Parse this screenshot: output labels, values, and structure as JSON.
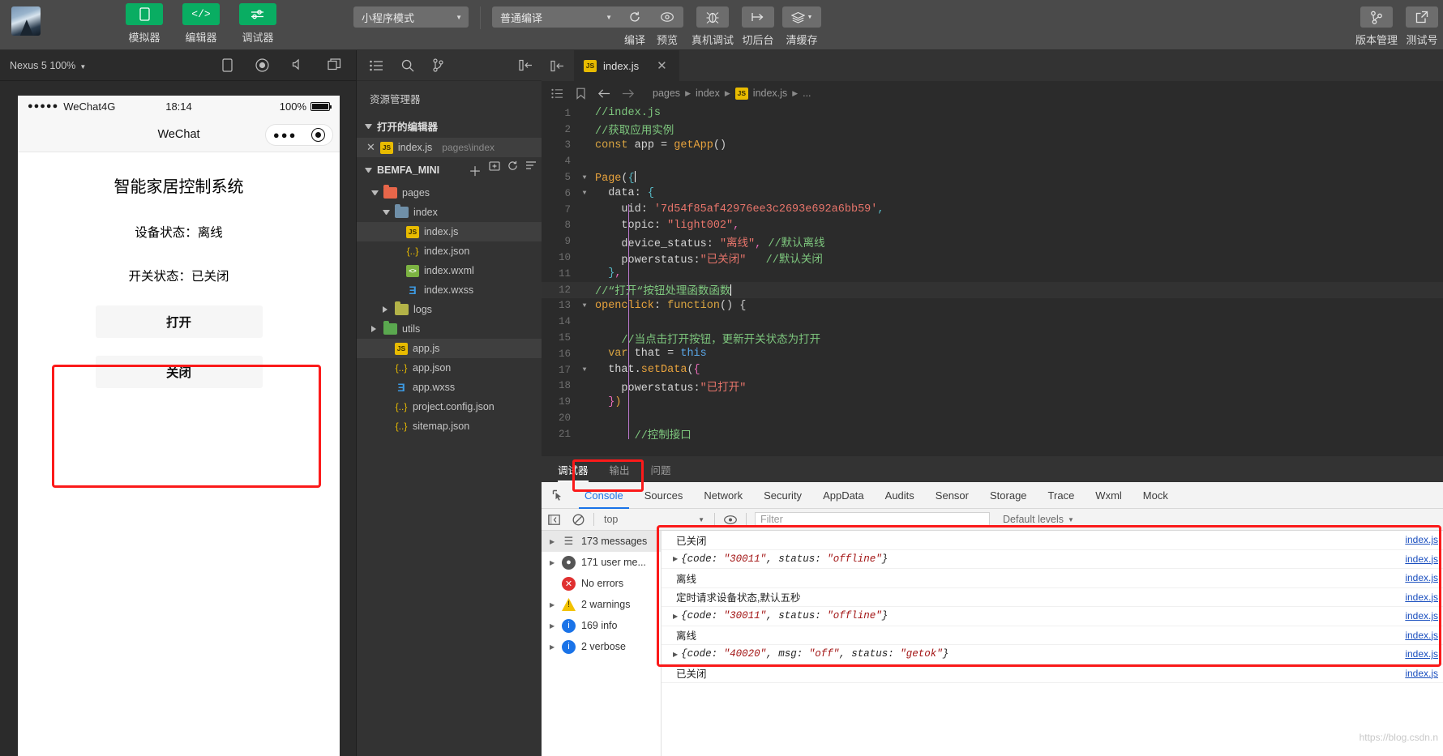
{
  "toolbar": {
    "avatar_name": "user-avatar",
    "buttons": [
      {
        "label": "模拟器",
        "icon": "phone-icon"
      },
      {
        "label": "编辑器",
        "icon": "code-icon"
      },
      {
        "label": "调试器",
        "icon": "sliders-icon"
      }
    ],
    "mode_select": "小程序模式",
    "compile_select": "普通编译",
    "actions": [
      {
        "label": "编译",
        "icon": "refresh-icon"
      },
      {
        "label": "预览",
        "icon": "eye-icon"
      },
      {
        "label": "真机调试",
        "icon": "bug-icon"
      },
      {
        "label": "切后台",
        "icon": "background-icon"
      },
      {
        "label": "清缓存",
        "icon": "layers-icon"
      }
    ],
    "right_actions": [
      {
        "label": "版本管理",
        "icon": "branch-icon"
      },
      {
        "label": "测试号",
        "icon": "external-link-icon"
      }
    ]
  },
  "simulator": {
    "device": "Nexus 5 100%",
    "status_bar": {
      "carrier": "WeChat4G",
      "dots": "●●●●●",
      "time": "18:14",
      "battery": "100%"
    },
    "nav_title": "WeChat",
    "page": {
      "title": "智能家居控制系统",
      "device_status": "设备状态：离线",
      "switch_status": "开关状态：已关闭",
      "open_button": "打开",
      "close_button": "关闭"
    }
  },
  "explorer": {
    "title": "资源管理器",
    "open_editors_label": "打开的编辑器",
    "open_editor_file": "index.js",
    "open_editor_path": "pages\\index",
    "project_name": "BEMFA_MINI",
    "tree": [
      {
        "name": "pages",
        "type": "folder",
        "color": "red",
        "indent": 1,
        "expanded": true,
        "selected": false
      },
      {
        "name": "index",
        "type": "folder",
        "color": "blue",
        "indent": 2,
        "expanded": true,
        "selected": false
      },
      {
        "name": "index.js",
        "type": "js",
        "indent": 3,
        "selected": true
      },
      {
        "name": "index.json",
        "type": "json",
        "indent": 3,
        "selected": false
      },
      {
        "name": "index.wxml",
        "type": "wxml",
        "indent": 3,
        "selected": false
      },
      {
        "name": "index.wxss",
        "type": "wxss",
        "indent": 3,
        "selected": false
      },
      {
        "name": "logs",
        "type": "folder",
        "color": "olive",
        "indent": 2,
        "expanded": false,
        "selected": false
      },
      {
        "name": "utils",
        "type": "folder",
        "color": "green",
        "indent": 1,
        "expanded": false,
        "selected": false
      },
      {
        "name": "app.js",
        "type": "js",
        "indent": 2,
        "selected": true
      },
      {
        "name": "app.json",
        "type": "json",
        "indent": 2,
        "selected": false
      },
      {
        "name": "app.wxss",
        "type": "wxss",
        "indent": 2,
        "selected": false
      },
      {
        "name": "project.config.json",
        "type": "json",
        "indent": 2,
        "selected": false
      },
      {
        "name": "sitemap.json",
        "type": "json",
        "indent": 2,
        "selected": false
      }
    ]
  },
  "editor": {
    "tab_name": "index.js",
    "breadcrumb": [
      "pages",
      "index",
      "index.js",
      "..."
    ],
    "lines": [
      {
        "n": 1,
        "fold": "",
        "html": "<span class='c-cmt'>//index.js</span>"
      },
      {
        "n": 2,
        "fold": "",
        "html": "<span class='c-cmt'>//获取应用实例</span>"
      },
      {
        "n": 3,
        "fold": "",
        "html": "<span class='c-key'>const</span><span class='c-pl'> app </span><span class='c-pun'>=</span><span class='c-fn'> getApp</span><span class='c-pun'>()</span>"
      },
      {
        "n": 4,
        "fold": "",
        "html": ""
      },
      {
        "n": 5,
        "fold": "v",
        "html": "<span class='c-fn'>Page</span><span class='c-pun'>(</span><span class='c-cyan'>{</span><span class='caret'></span>"
      },
      {
        "n": 6,
        "fold": "v",
        "html": "  <span class='c-pl'>data:</span> <span class='c-cyan'>{</span>"
      },
      {
        "n": 7,
        "fold": "",
        "html": "    <span class='c-pl'>uid:</span> <span class='c-str'>'7d54f85af42976ee3c2693e692a6bb59'</span><span class='c-cyan'>,</span>"
      },
      {
        "n": 8,
        "fold": "",
        "html": "    <span class='c-pl'>topic:</span> <span class='c-str'>\"light002\"</span><span class='c-pink'>,</span>"
      },
      {
        "n": 9,
        "fold": "",
        "html": "    <span class='c-pl'>device_status:</span> <span class='c-str'>\"离线\"</span><span class='c-pink'>,</span> <span class='c-cmt'>//默认离线</span>"
      },
      {
        "n": 10,
        "fold": "",
        "html": "    <span class='c-pl'>powerstatus:</span><span class='c-str'>\"已关闭\"</span>   <span class='c-cmt'>//默认关闭</span>"
      },
      {
        "n": 11,
        "fold": "",
        "html": "  <span class='c-cyan'>}</span><span class='c-pink'>,</span>"
      },
      {
        "n": 12,
        "fold": "",
        "hl": true,
        "html": "<span class='c-cmt'>//“打开“按钮处理函数函数</span><span class='caret'></span>"
      },
      {
        "n": 13,
        "fold": "v",
        "html": "<span class='c-fn'>openclick</span><span class='c-pl'>: </span><span class='c-key'>function</span><span class='c-pun'>() {</span>"
      },
      {
        "n": 14,
        "fold": "",
        "html": ""
      },
      {
        "n": 15,
        "fold": "",
        "html": "    <span class='c-cmt'>//当点击打开按钮，更新开关状态为打开</span>"
      },
      {
        "n": 16,
        "fold": "",
        "html": "  <span class='c-key'>var</span><span class='c-pl'> that </span><span class='c-pun'>=</span> <span class='c-blue'>this</span>"
      },
      {
        "n": 17,
        "fold": "v",
        "html": "  <span class='c-pl'>that.</span><span class='c-fn'>setData</span><span class='c-pun'>(</span><span class='c-pink'>{</span>"
      },
      {
        "n": 18,
        "fold": "",
        "html": "    <span class='c-pl'>powerstatus:</span><span class='c-str'>\"已打开\"</span>"
      },
      {
        "n": 19,
        "fold": "",
        "html": "  <span class='c-pink'>}</span><span class='c-fn'>)</span>"
      },
      {
        "n": 20,
        "fold": "",
        "html": ""
      },
      {
        "n": 21,
        "fold": "",
        "html": "      <span class='c-cmt'>//控制接口</span>"
      }
    ]
  },
  "debug": {
    "panel_tabs": [
      {
        "label": "调试器",
        "active": true
      },
      {
        "label": "输出",
        "active": false
      },
      {
        "label": "问题",
        "active": false
      }
    ],
    "devtools_tabs": [
      {
        "label": "Console",
        "active": true
      },
      {
        "label": "Sources",
        "active": false
      },
      {
        "label": "Network",
        "active": false
      },
      {
        "label": "Security",
        "active": false
      },
      {
        "label": "AppData",
        "active": false
      },
      {
        "label": "Audits",
        "active": false
      },
      {
        "label": "Sensor",
        "active": false
      },
      {
        "label": "Storage",
        "active": false
      },
      {
        "label": "Trace",
        "active": false
      },
      {
        "label": "Wxml",
        "active": false
      },
      {
        "label": "Mock",
        "active": false
      }
    ],
    "filterbar": {
      "context": "top",
      "filter_placeholder": "Filter",
      "levels": "Default levels"
    },
    "sidebar": [
      {
        "label": "173 messages",
        "icon": "list-icon",
        "expandable": true,
        "selected": true
      },
      {
        "label": "171 user me...",
        "icon": "user-icon",
        "expandable": true,
        "selected": false
      },
      {
        "label": "No errors",
        "icon": "error-icon",
        "expandable": false,
        "selected": false
      },
      {
        "label": "2 warnings",
        "icon": "warning-icon",
        "expandable": true,
        "selected": false
      },
      {
        "label": "169 info",
        "icon": "info-icon",
        "expandable": true,
        "selected": false
      },
      {
        "label": "2 verbose",
        "icon": "verbose-icon",
        "expandable": true,
        "selected": false
      }
    ],
    "logs": [
      {
        "text": "已关闭",
        "mono": false,
        "expandable": false,
        "source": "index.js"
      },
      {
        "text": "{code: \"30011\", status: \"offline\"}",
        "mono": true,
        "expandable": true,
        "source": "index.js"
      },
      {
        "text": "离线",
        "mono": false,
        "expandable": false,
        "source": "index.js"
      },
      {
        "text": "定时请求设备状态,默认五秒",
        "mono": false,
        "expandable": false,
        "source": "index.js"
      },
      {
        "text": "{code: \"30011\", status: \"offline\"}",
        "mono": true,
        "expandable": true,
        "source": "index.js"
      },
      {
        "text": "离线",
        "mono": false,
        "expandable": false,
        "source": "index.js"
      },
      {
        "text": "{code: \"40020\", msg: \"off\", status: \"getok\"}",
        "mono": true,
        "expandable": true,
        "source": "index.js"
      },
      {
        "text": "已关闭",
        "mono": false,
        "expandable": false,
        "source": "index.js"
      }
    ],
    "watermark": "https://blog.csdn.n"
  },
  "colors": {
    "accent_green": "#09ad62",
    "highlight_red": "#fb1a1a",
    "devtools_blue": "#1a73e8"
  }
}
